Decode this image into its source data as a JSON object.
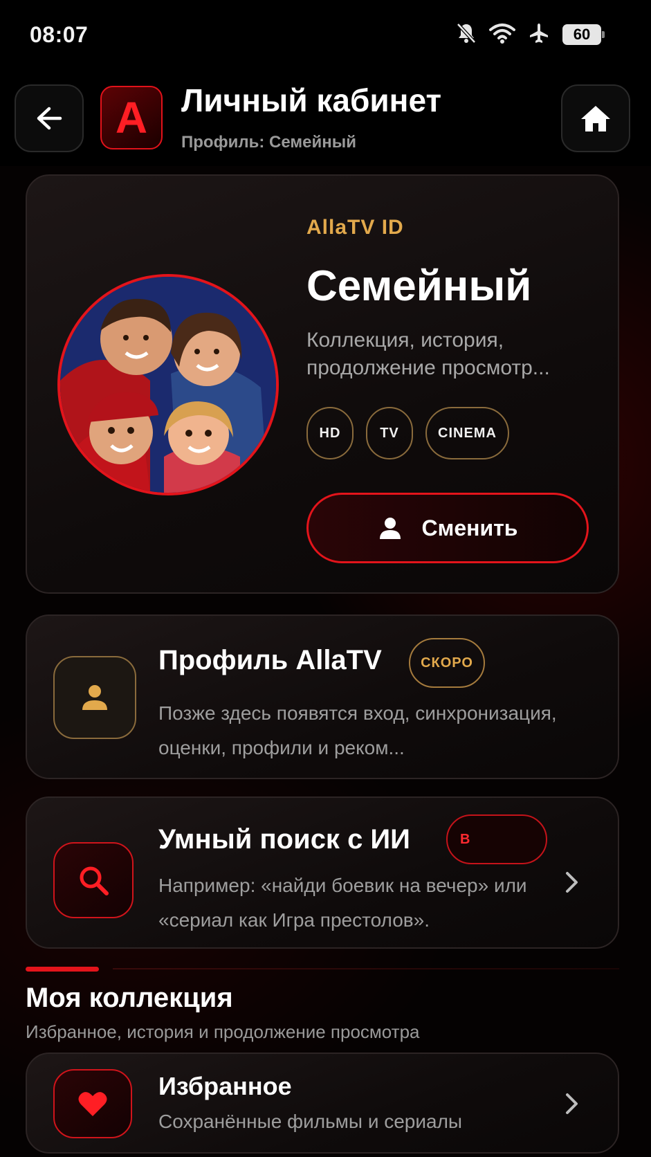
{
  "status_bar": {
    "time": "08:07",
    "battery": "60"
  },
  "header": {
    "title": "Личный кабинет",
    "subtitle": "Профиль: Семейный",
    "logo_letter": "A"
  },
  "profile_card": {
    "id_label": "AllaTV ID",
    "name": "Семейный",
    "description": "Коллекция, история, продолжение просмотр...",
    "tags": [
      "HD",
      "TV",
      "CINEMA"
    ],
    "switch_label": "Сменить"
  },
  "allatv_profile": {
    "title": "Профиль AllaTV",
    "badge": "СКОРО",
    "text": "Позже здесь появятся вход, синхронизация, оценки, профили и реком..."
  },
  "smart_search": {
    "title": "Умный поиск с ИИ",
    "badge": "В",
    "text": "Например: «найди боевик на вечер» или «сериал как Игра престолов»."
  },
  "collection": {
    "title": "Моя коллекция",
    "subtitle": "Избранное, история и продолжение просмотра",
    "favorites_title": "Избранное",
    "favorites_text": "Сохранённые фильмы и сериалы"
  },
  "colors": {
    "accent_red": "#e3141b",
    "accent_gold": "#e2a94c",
    "background": "#000000"
  }
}
